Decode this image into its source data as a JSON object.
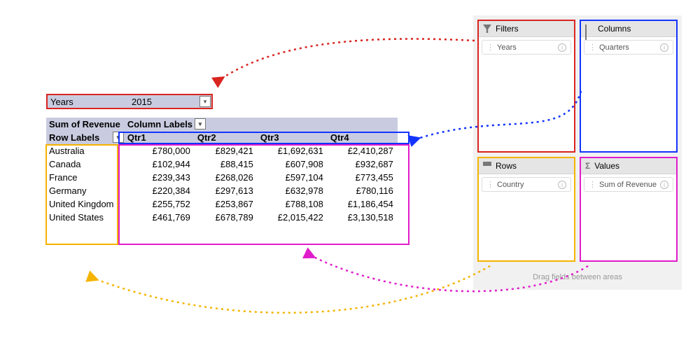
{
  "filter": {
    "label": "Years",
    "value": "2015"
  },
  "pivot": {
    "corner_top": "Sum of Revenue",
    "column_labels_caption": "Column Labels",
    "row_labels_caption": "Row Labels",
    "columns": [
      "Qtr1",
      "Qtr2",
      "Qtr3",
      "Qtr4"
    ],
    "rows": [
      {
        "label": "Australia",
        "cells": [
          "£780,000",
          "£829,421",
          "£1,692,631",
          "£2,410,287"
        ]
      },
      {
        "label": "Canada",
        "cells": [
          "£102,944",
          "£88,415",
          "£607,908",
          "£932,687"
        ]
      },
      {
        "label": "France",
        "cells": [
          "£239,343",
          "£268,026",
          "£597,104",
          "£773,455"
        ]
      },
      {
        "label": "Germany",
        "cells": [
          "£220,384",
          "£297,613",
          "£632,978",
          "£780,116"
        ]
      },
      {
        "label": "United Kingdom",
        "cells": [
          "£255,752",
          "£253,867",
          "£788,108",
          "£1,186,454"
        ]
      },
      {
        "label": "United States",
        "cells": [
          "£461,769",
          "£678,789",
          "£2,015,422",
          "£3,130,518"
        ]
      }
    ]
  },
  "areas": {
    "filters": {
      "title": "Filters",
      "fields": [
        "Years"
      ]
    },
    "columns": {
      "title": "Columns",
      "fields": [
        "Quarters"
      ]
    },
    "rows": {
      "title": "Rows",
      "fields": [
        "Country"
      ]
    },
    "values": {
      "title": "Values",
      "fields": [
        "Sum of Revenue"
      ]
    }
  },
  "hint": "Drag fields between areas",
  "colors": {
    "filters": "#d9241f",
    "columns": "#1334ff",
    "rows": "#f5b400",
    "values": "#e11ccb"
  }
}
